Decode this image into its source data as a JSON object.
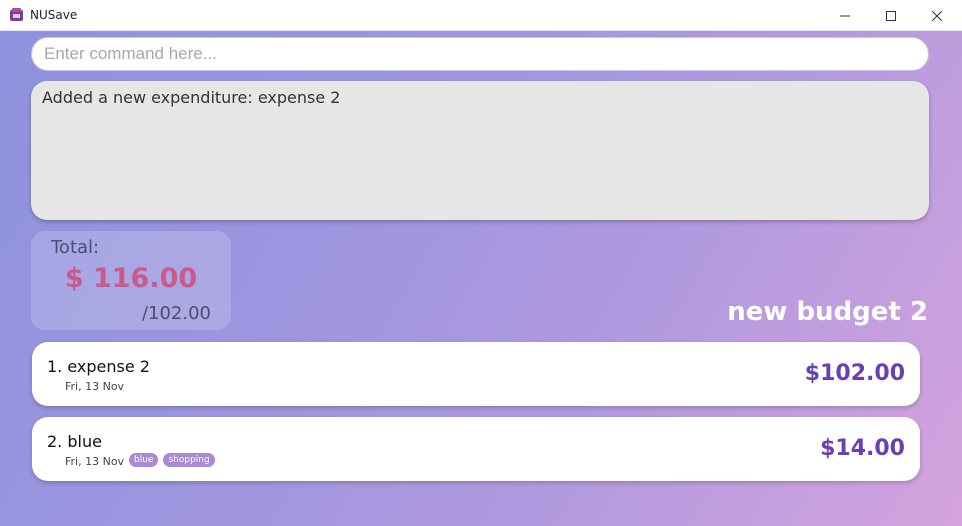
{
  "window": {
    "title": "NUSave"
  },
  "command": {
    "placeholder": "Enter command here..."
  },
  "result": {
    "text": "Added a new expenditure: expense 2"
  },
  "total": {
    "label": "Total:",
    "amount": "$ 116.00",
    "budget": "/102.00"
  },
  "budget": {
    "name": "new budget 2"
  },
  "expenditures": [
    {
      "title": "1. expense 2",
      "date": "Fri, 13 Nov",
      "amount": "$102.00",
      "tags": []
    },
    {
      "title": "2. blue",
      "date": "Fri, 13 Nov",
      "amount": "$14.00",
      "tags": [
        "blue",
        "shopping"
      ]
    }
  ],
  "colors": {
    "accent": "#6a3fb0",
    "total_amount": "#c95a8a",
    "tag": "#a98ad8"
  },
  "icons": {
    "app": "nusave-app-icon",
    "minimize": "minimize-icon",
    "maximize": "maximize-icon",
    "close": "close-icon"
  }
}
